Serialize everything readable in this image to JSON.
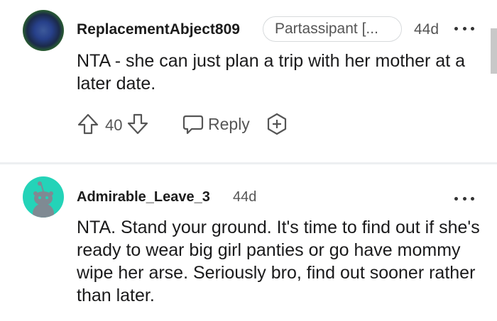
{
  "comments": [
    {
      "username": "ReplacementAbject809",
      "flair": "Partassipant [...",
      "time": "44d",
      "body": "NTA - she can just plan a trip with her mother at a later date.",
      "score": "40",
      "reply_label": "Reply"
    },
    {
      "username": "Admirable_Leave_3",
      "time": "44d",
      "body": "NTA. Stand your ground. It's time to find out if she's ready to wear big girl panties or go have mommy wipe her arse. Seriously bro, find out sooner rather than later."
    }
  ],
  "colors": {
    "snoo_teal": "#24d3b8",
    "text": "#1a1a1b",
    "meta": "#555555",
    "divider": "#edeff1"
  }
}
